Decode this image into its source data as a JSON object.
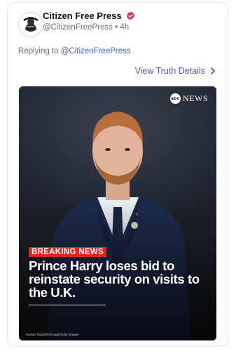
{
  "post": {
    "display_name": "Citizen Free Press",
    "handle": "@CitizenFreePress",
    "separator": "•",
    "time_ago": "4h",
    "replying_prefix": "Replying to",
    "replying_to": "@CitizenFreePress",
    "view_details": "View Truth Details"
  },
  "media": {
    "network": "NEWS",
    "network_badge": "abc",
    "breaking_label": "BREAKING NEWS",
    "headline": "Prince Harry loses bid to reinstate security on visits to the U.K.",
    "photo_credit": "Karwai Tang/Wireimage/Getty Images"
  },
  "icons": {
    "verified": "verified-badge-icon",
    "chevron": "chevron-right-icon"
  },
  "colors": {
    "accent": "#4a54d9",
    "verified": "#e2385c",
    "breaking": "#e0251b"
  }
}
